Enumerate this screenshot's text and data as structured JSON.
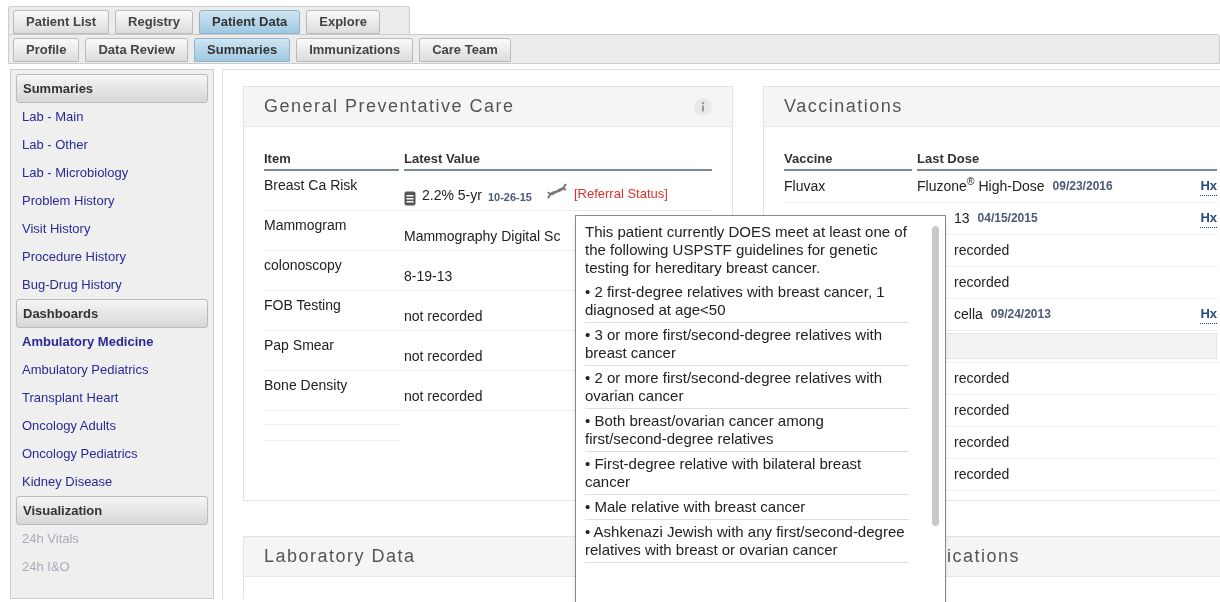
{
  "top_tabs": [
    {
      "label": "Patient List",
      "selected": false
    },
    {
      "label": "Registry",
      "selected": false
    },
    {
      "label": "Patient Data",
      "selected": true
    },
    {
      "label": "Explore",
      "selected": false
    }
  ],
  "sub_tabs": [
    {
      "label": "Profile",
      "selected": false
    },
    {
      "label": "Data Review",
      "selected": false
    },
    {
      "label": "Summaries",
      "selected": true
    },
    {
      "label": "Immunizations",
      "selected": false
    },
    {
      "label": "Care Team",
      "selected": false
    }
  ],
  "sidebar": [
    {
      "title": "Summaries",
      "items": [
        {
          "label": "Lab - Main",
          "selected": false,
          "disabled": false
        },
        {
          "label": "Lab - Other",
          "selected": false,
          "disabled": false
        },
        {
          "label": "Lab - Microbiology",
          "selected": false,
          "disabled": false
        },
        {
          "label": "Problem History",
          "selected": false,
          "disabled": false
        },
        {
          "label": "Visit History",
          "selected": false,
          "disabled": false
        },
        {
          "label": "Procedure History",
          "selected": false,
          "disabled": false
        },
        {
          "label": "Bug-Drug History",
          "selected": false,
          "disabled": false
        }
      ]
    },
    {
      "title": "Dashboards",
      "items": [
        {
          "label": "Ambulatory Medicine",
          "selected": true,
          "disabled": false
        },
        {
          "label": "Ambulatory Pediatrics",
          "selected": false,
          "disabled": false
        },
        {
          "label": "Transplant Heart",
          "selected": false,
          "disabled": false
        },
        {
          "label": "Oncology Adults",
          "selected": false,
          "disabled": false
        },
        {
          "label": "Oncology Pediatrics",
          "selected": false,
          "disabled": false
        },
        {
          "label": "Kidney Disease",
          "selected": false,
          "disabled": false
        }
      ]
    },
    {
      "title": "Visualization",
      "items": [
        {
          "label": "24h Vitals",
          "selected": false,
          "disabled": true
        },
        {
          "label": "24h I&O",
          "selected": false,
          "disabled": true
        }
      ]
    }
  ],
  "preventive_care": {
    "title": "General Preventative Care",
    "columns": [
      "Item",
      "Latest Value"
    ],
    "rows": [
      {
        "kind": "risk",
        "item": "Breast Ca Risk",
        "value": "2.2% 5-yr",
        "date": "10-26-15",
        "link": "[Referral Status]"
      },
      {
        "kind": "text",
        "item": "Mammogram",
        "value": "Mammography Digital Sc"
      },
      {
        "kind": "text",
        "item": "colonoscopy",
        "value": "8-19-13"
      },
      {
        "kind": "text",
        "item": "FOB Testing",
        "value": "not recorded"
      },
      {
        "kind": "text",
        "item": "Pap Smear",
        "value": "not recorded"
      },
      {
        "kind": "text",
        "item": "Bone Density",
        "value": "not recorded"
      }
    ]
  },
  "vaccinations": {
    "title": "Vaccinations",
    "columns": [
      "Vaccine",
      "Last Dose"
    ],
    "rows": [
      {
        "kind": "dose",
        "vaccine": "Fluvax",
        "dose": "Fluzone$^{®}$ High-Dose",
        "date": "09/23/2016",
        "link": "Hx"
      },
      {
        "kind": "dose",
        "dose": "13",
        "date": "04/15/2015",
        "link": "Hx"
      },
      {
        "kind": "dose",
        "dose": "recorded"
      },
      {
        "kind": "dose",
        "dose": "recorded"
      },
      {
        "kind": "dose",
        "dose": "cella",
        "date": "09/24/2013",
        "link": "Hx"
      },
      {
        "kind": "blank"
      },
      {
        "kind": "dose",
        "dose": "recorded"
      },
      {
        "kind": "dose",
        "dose": "recorded"
      },
      {
        "kind": "dose",
        "dose": "recorded"
      },
      {
        "kind": "dose",
        "dose": "recorded"
      }
    ]
  },
  "laboratory": {
    "title": "Laboratory Data"
  },
  "medications": {
    "title": "ications"
  },
  "popup": {
    "intro": "This patient currently DOES meet at least one of the following USPSTF guidelines for genetic testing for hereditary breast cancer.",
    "criteria": [
      "•  2 first-degree relatives with breast cancer, 1 diagnosed at age<50",
      "•  3 or more first/second-degree relatives with breast cancer",
      "•  2 or more first/second-degree relatives with ovarian cancer",
      "•  Both breast/ovarian cancer among first/second-degree relatives",
      "•  First-degree relative with bilateral breast cancer",
      "•  Male relative with breast cancer",
      "•  Ashkenazi Jewish with any first/second-degree relatives with breast or ovarian cancer"
    ]
  }
}
